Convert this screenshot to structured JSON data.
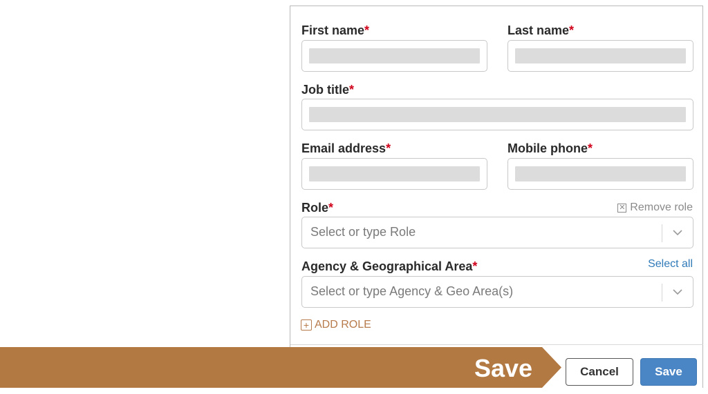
{
  "form": {
    "first_name": {
      "label": "First name",
      "required": "*"
    },
    "last_name": {
      "label": "Last name",
      "required": "*"
    },
    "job_title": {
      "label": "Job title",
      "required": "*"
    },
    "email": {
      "label": "Email address",
      "required": "*"
    },
    "mobile": {
      "label": "Mobile phone",
      "required": "*"
    },
    "role": {
      "label": "Role",
      "required": "*",
      "placeholder": "Select or type Role",
      "remove_label": "Remove role"
    },
    "agency": {
      "label": "Agency & Geographical Area",
      "required": "*",
      "placeholder": "Select or type Agency & Geo Area(s)",
      "select_all_label": "Select all"
    },
    "add_role_label": "ADD ROLE"
  },
  "footer": {
    "cancel_label": "Cancel",
    "save_label": "Save"
  },
  "callout": {
    "text": "Save",
    "color": "#b37943"
  },
  "colors": {
    "required": "#d0021b",
    "link": "#2f7ab8",
    "add_role": "#b77a4a",
    "save_button": "#4a86c5"
  }
}
